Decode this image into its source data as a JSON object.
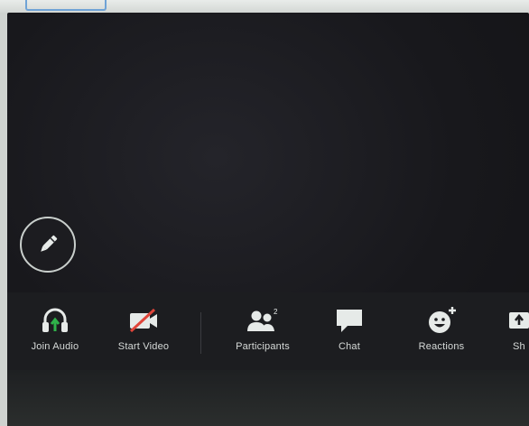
{
  "toolbar": {
    "items": [
      {
        "label": "Join Audio",
        "icon": "headphones-icon"
      },
      {
        "label": "Start Video",
        "icon": "video-off-icon"
      },
      {
        "label": "Participants",
        "icon": "participants-icon",
        "badge": "2"
      },
      {
        "label": "Chat",
        "icon": "chat-icon"
      },
      {
        "label": "Reactions",
        "icon": "reactions-icon"
      },
      {
        "label": "Sh",
        "icon": "share-icon"
      }
    ]
  },
  "annotate": {
    "icon": "pencil-icon"
  },
  "colors": {
    "background": "#18181c",
    "toolbar": "#1c1d20",
    "audio_accent": "#2fb34a",
    "video_off": "#e0453a"
  }
}
